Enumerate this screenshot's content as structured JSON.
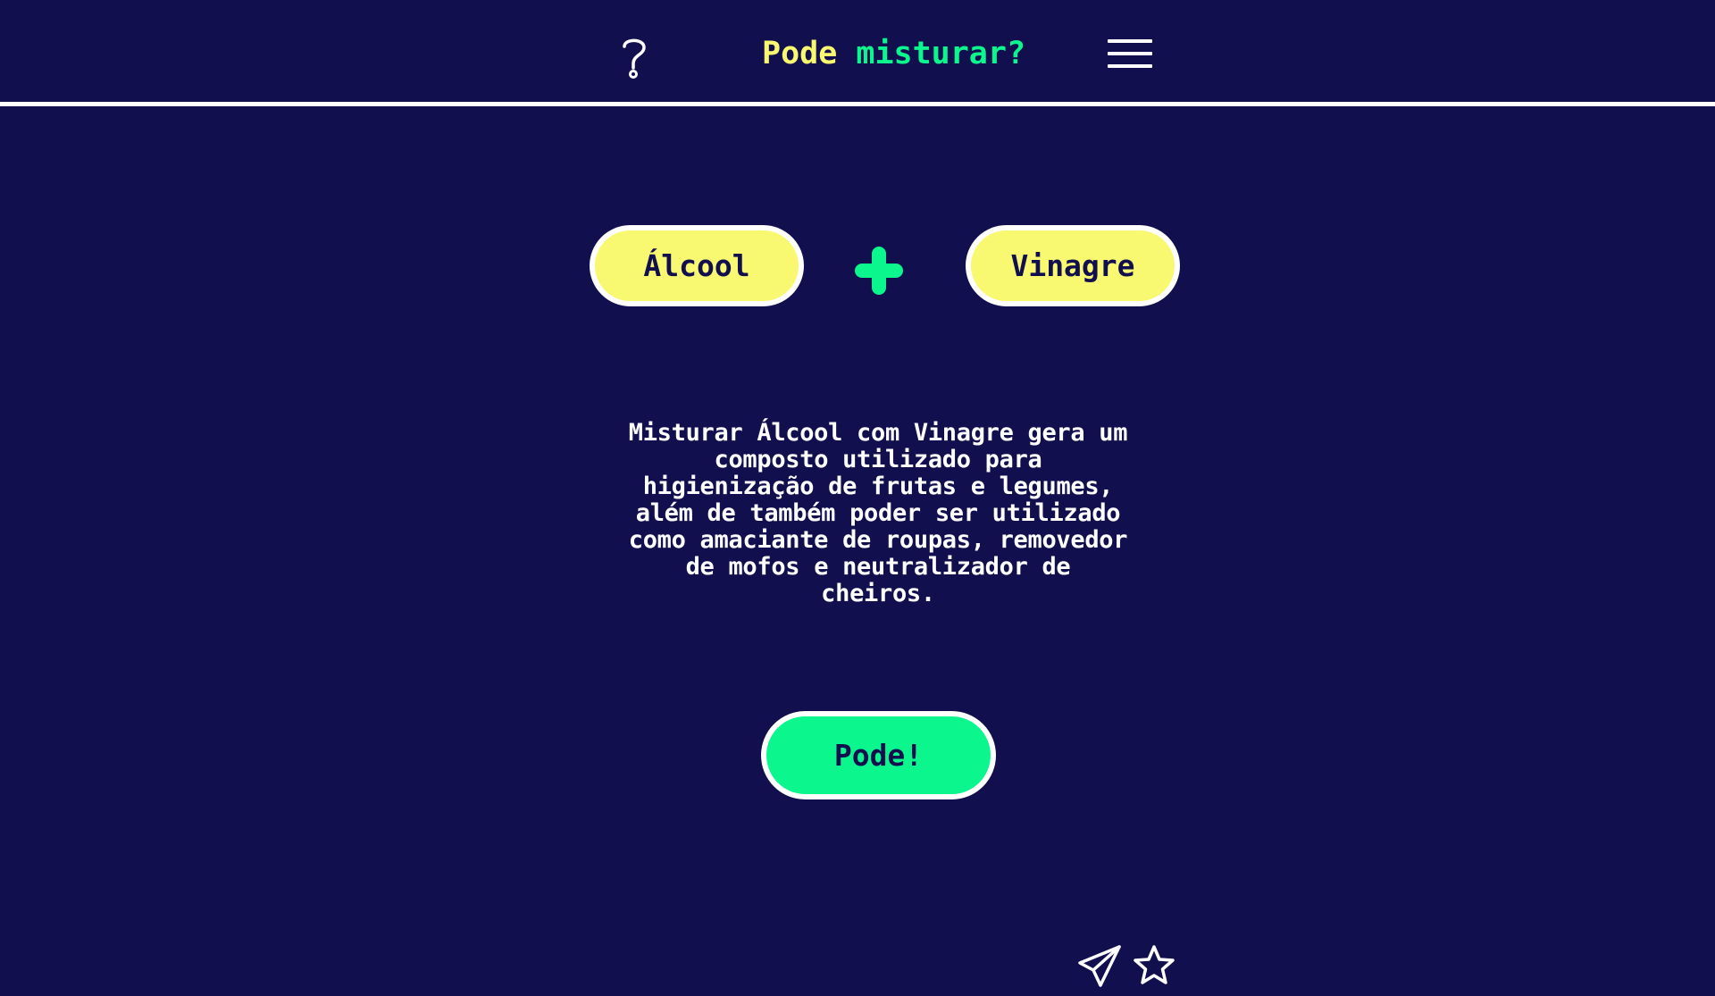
{
  "header": {
    "title_part1": "Pode",
    "title_part2": "misturar?",
    "help_icon": "question-mark-icon",
    "menu_icon": "hamburger-menu-icon"
  },
  "mixer": {
    "ingredient_a": "Álcool",
    "ingredient_b": "Vinagre",
    "operator_icon": "plus-icon"
  },
  "result": {
    "description": "Misturar Álcool com Vinagre gera um composto utilizado para higienização de frutas e legumes, além de também poder ser utilizado como amaciante de roupas, removedor de mofos e neutralizador de cheiros.",
    "verdict": "Pode!"
  },
  "footer": {
    "send_icon": "paper-plane-icon",
    "favorite_icon": "star-icon"
  },
  "colors": {
    "background": "#120f4f",
    "accent_yellow": "#f9f871",
    "accent_green": "#0cf68e",
    "white": "#ffffff"
  }
}
